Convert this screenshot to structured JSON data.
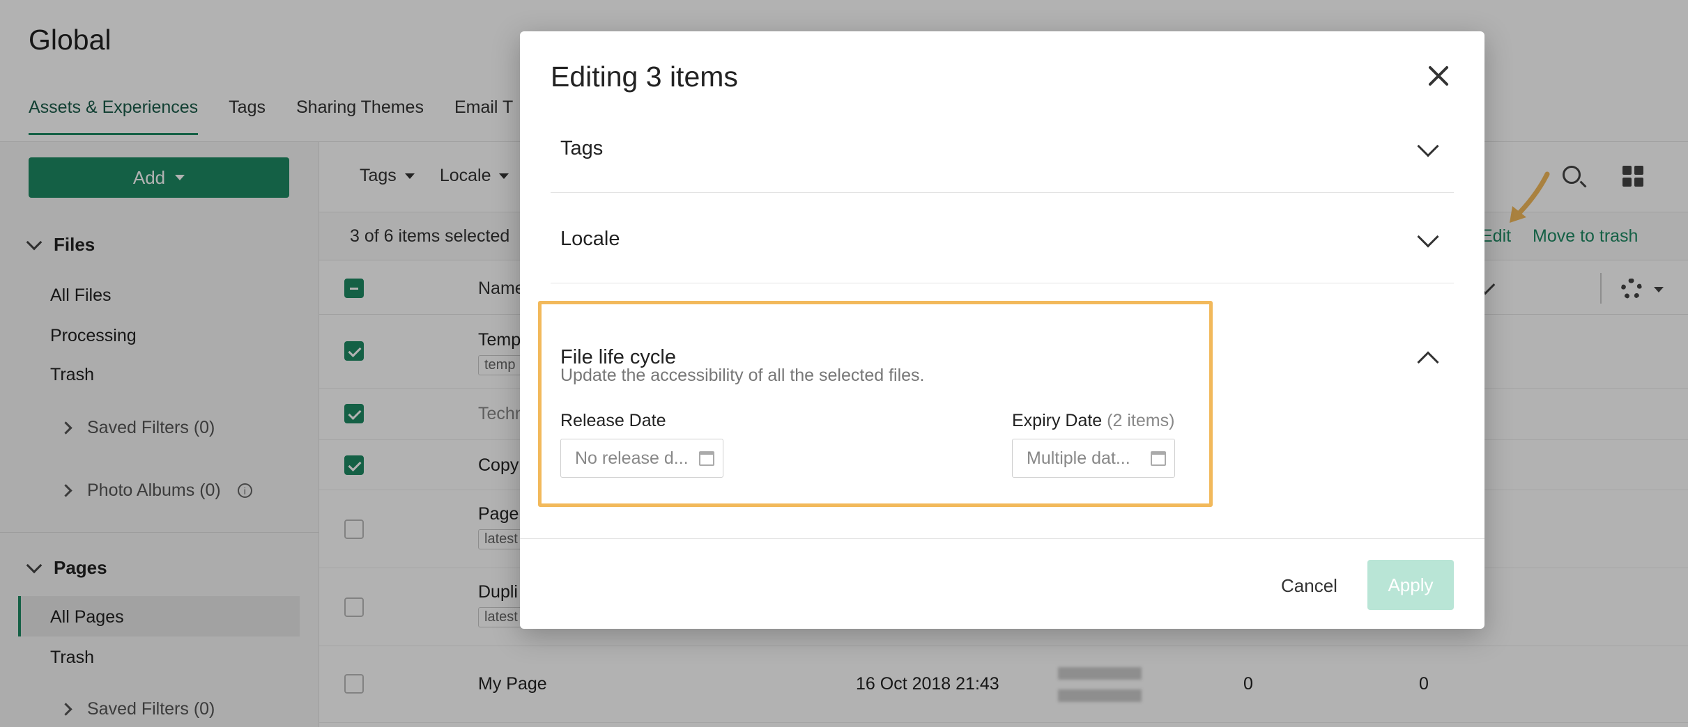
{
  "app": {
    "title": "Global",
    "tabs": [
      "Assets & Experiences",
      "Tags",
      "Sharing Themes",
      "Email T"
    ]
  },
  "sidebar": {
    "add_label": "Add",
    "files_section": "Files",
    "files_items": [
      "All Files",
      "Processing",
      "Trash"
    ],
    "files_saved_filters": "Saved Filters (0)",
    "photo_albums": "Photo Albums (0)",
    "pages_section": "Pages",
    "pages_items": [
      "All Pages",
      "Trash"
    ],
    "pages_saved_filters": "Saved Filters (0)"
  },
  "main": {
    "filters": [
      "Tags",
      "Locale"
    ],
    "selection_count": "3 of 6 items selected",
    "actions": {
      "edit": "Edit",
      "trash": "Move to trash"
    },
    "column_name": "Name",
    "rows": [
      {
        "name": "Temp",
        "tag": "temp"
      },
      {
        "name": "Techn"
      },
      {
        "name": "Copy"
      },
      {
        "name": "Page",
        "tag": "latest"
      },
      {
        "name": "Dupli",
        "tag": "latest"
      },
      {
        "name": "My Page",
        "date": "16 Oct 2018 21:43",
        "count_a": "0",
        "count_b": "0"
      }
    ]
  },
  "modal": {
    "title": "Editing 3 items",
    "sections": {
      "tags": "Tags",
      "locale": "Locale",
      "lifecycle": "File life cycle"
    },
    "lifecycle": {
      "description": "Update the accessibility of all the selected files.",
      "release_label": "Release Date",
      "release_placeholder": "No release d...",
      "expiry_label": "Expiry Date",
      "expiry_count": "(2 items)",
      "expiry_placeholder": "Multiple dat..."
    },
    "cancel_label": "Cancel",
    "apply_label": "Apply"
  }
}
